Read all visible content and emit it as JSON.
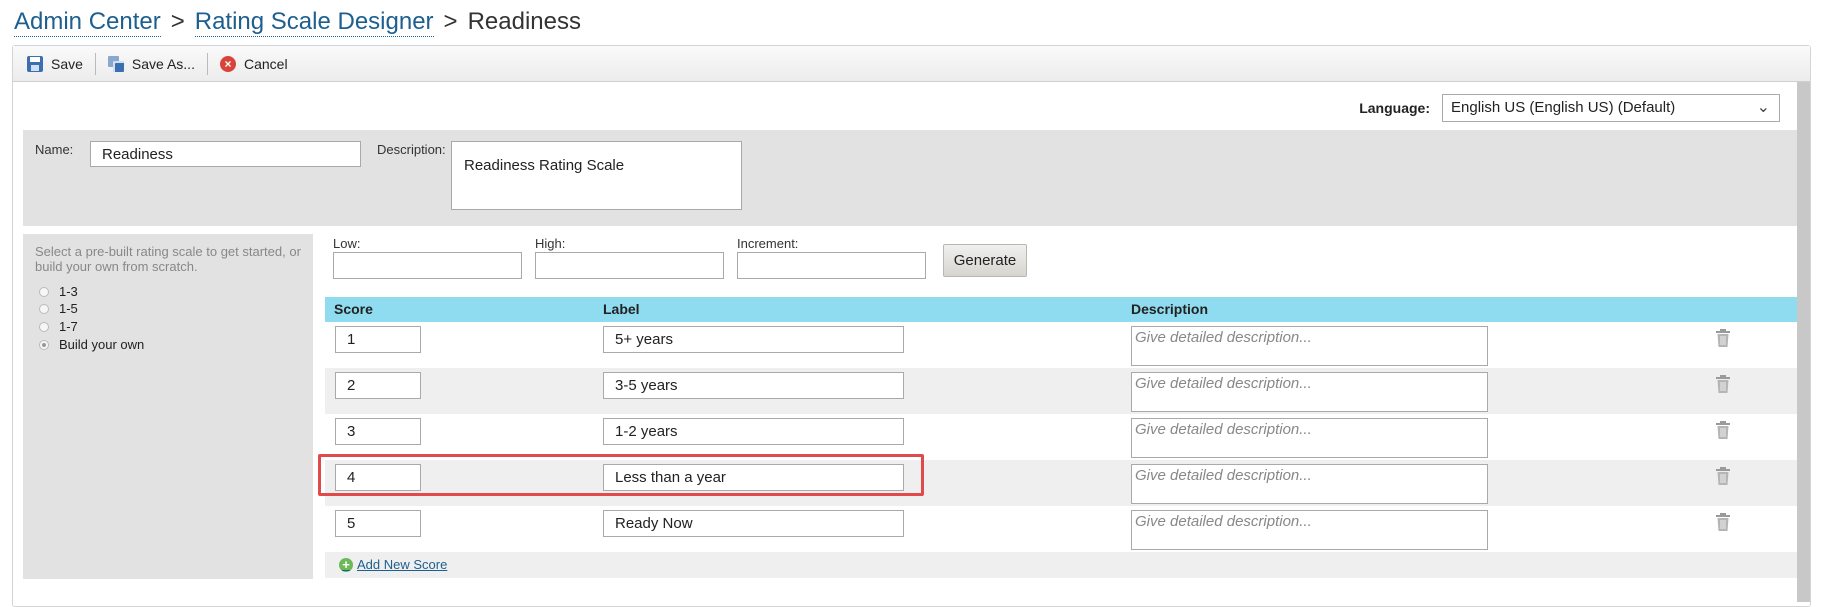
{
  "breadcrumb": {
    "items": [
      "Admin Center",
      "Rating Scale Designer"
    ],
    "separator": ">",
    "current": "Readiness"
  },
  "toolbar": {
    "save_label": "Save",
    "save_as_label": "Save As...",
    "cancel_label": "Cancel"
  },
  "language": {
    "label": "Language:",
    "selected": "English US (English US) (Default)"
  },
  "form": {
    "name_label": "Name:",
    "name_value": "Readiness",
    "description_label": "Description:",
    "description_value": "Readiness Rating Scale"
  },
  "prebuilt": {
    "help_text": "Select a pre-built rating scale to get started, or build your own from scratch.",
    "options": [
      "1-3",
      "1-5",
      "1-7",
      "Build your own"
    ],
    "selected": "Build your own"
  },
  "generator": {
    "low_label": "Low:",
    "high_label": "High:",
    "increment_label": "Increment:",
    "low_value": "",
    "high_value": "",
    "increment_value": "",
    "button_label": "Generate"
  },
  "table": {
    "headers": [
      "Score",
      "Label",
      "Description"
    ],
    "description_placeholder": "Give detailed description...",
    "rows": [
      {
        "score": "1",
        "label": "5+ years"
      },
      {
        "score": "2",
        "label": "3-5 years"
      },
      {
        "score": "3",
        "label": "1-2 years"
      },
      {
        "score": "4",
        "label": "Less than a year"
      },
      {
        "score": "5",
        "label": "Ready Now"
      }
    ],
    "highlighted_row": "4"
  },
  "add_score_label": "Add New Score",
  "colors": {
    "link": "#1d5f8f",
    "table_header_bg": "#8fdbf0",
    "highlight_border": "#e04a4a",
    "panel_bg": "#e2e2e2"
  }
}
